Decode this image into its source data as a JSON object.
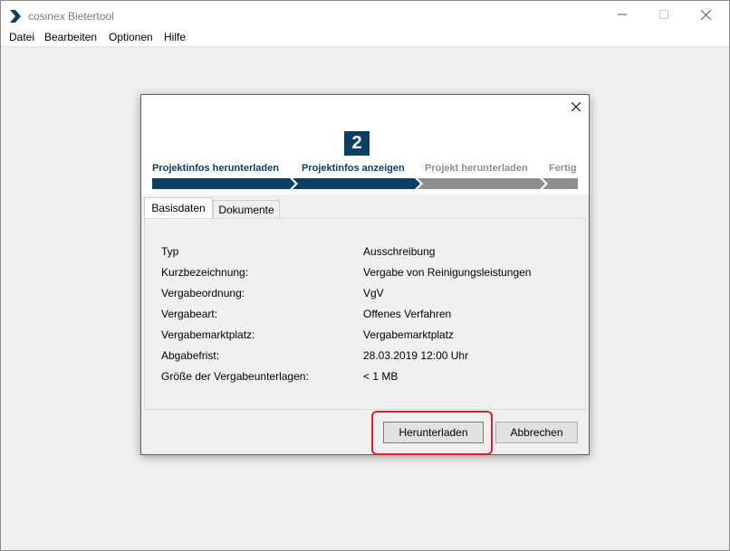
{
  "window": {
    "title": "cosinex Bietertool",
    "icon": "chevron-right-icon"
  },
  "menu": {
    "items": [
      "Datei",
      "Bearbeiten",
      "Optionen",
      "Hilfe"
    ]
  },
  "dialog": {
    "step_number": "2",
    "steps": [
      {
        "label": "Projektinfos herunterladen",
        "state": "done"
      },
      {
        "label": "Projektinfos anzeigen",
        "state": "current"
      },
      {
        "label": "Projekt herunterladen",
        "state": "todo"
      },
      {
        "label": "Fertig",
        "state": "todo"
      }
    ],
    "tabs": [
      {
        "label": "Basisdaten",
        "active": true
      },
      {
        "label": "Dokumente",
        "active": false
      }
    ],
    "details": [
      {
        "label": "Typ",
        "value": "Ausschreibung"
      },
      {
        "label": "Kurzbezeichnung:",
        "value": "Vergabe von Reinigungsleistungen"
      },
      {
        "label": "Vergabeordnung:",
        "value": "VgV"
      },
      {
        "label": "Vergabeart:",
        "value": "Offenes Verfahren"
      },
      {
        "label": "Vergabemarktplatz:",
        "value": "Vergabemarktplatz"
      },
      {
        "label": "Abgabefrist:",
        "value": "28.03.2019 12:00 Uhr"
      },
      {
        "label": "Größe der Vergabeunterlagen:",
        "value": "< 1 MB"
      }
    ],
    "buttons": {
      "download": "Herunterladen",
      "cancel": "Abbrechen"
    }
  },
  "colors": {
    "accent": "#0d3e63",
    "inactive_step": "#8e8e8e",
    "highlight": "#e0202a"
  }
}
